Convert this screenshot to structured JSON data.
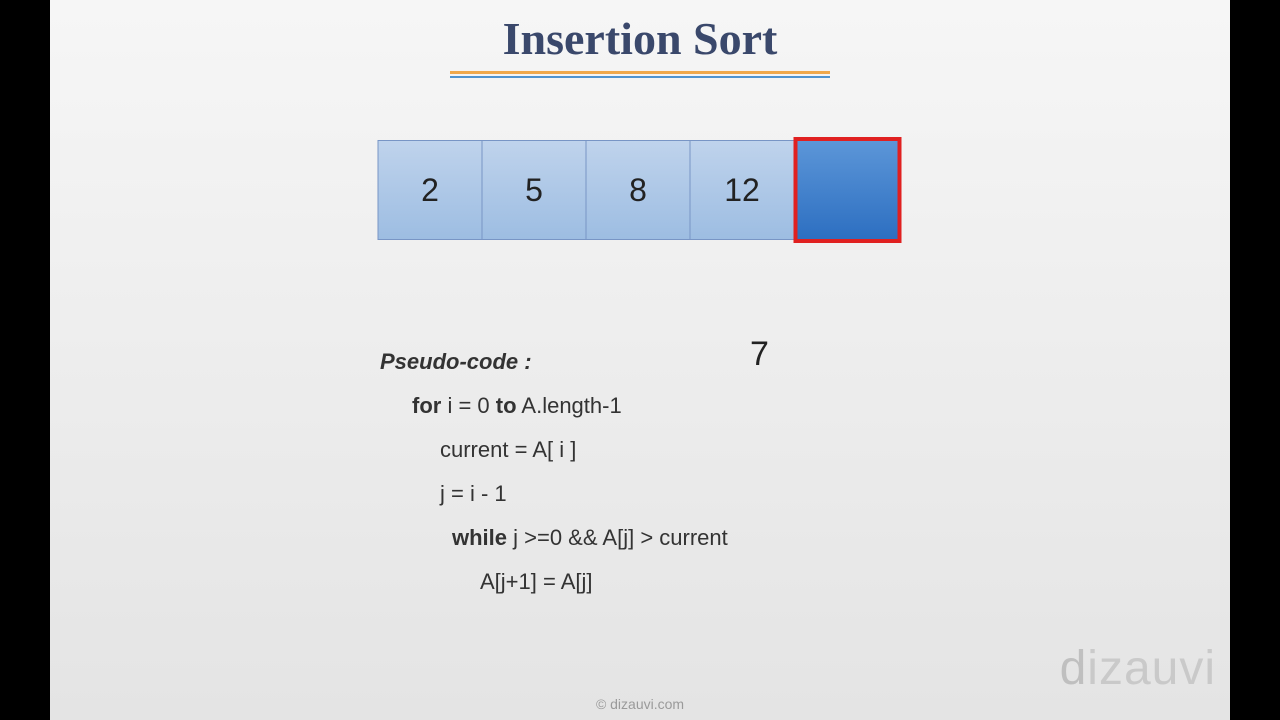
{
  "title": "Insertion Sort",
  "array": {
    "cells": [
      "2",
      "5",
      "8",
      "12",
      ""
    ],
    "highlight_index": 4
  },
  "floating_value": "7",
  "pseudo": {
    "label": "Pseudo-code :",
    "line1_kw1": "for",
    "line1_rest1": " i = 0 ",
    "line1_kw2": "to",
    "line1_rest2": " A.length-1",
    "line2": "current =  A[ i ]",
    "line3": "j  =  i - 1",
    "line4_kw": "while",
    "line4_rest": "  j >=0 && A[j] > current",
    "line5": "A[j+1] = A[j]"
  },
  "copyright": "© dizauvi.com",
  "watermark": "dizauvi"
}
